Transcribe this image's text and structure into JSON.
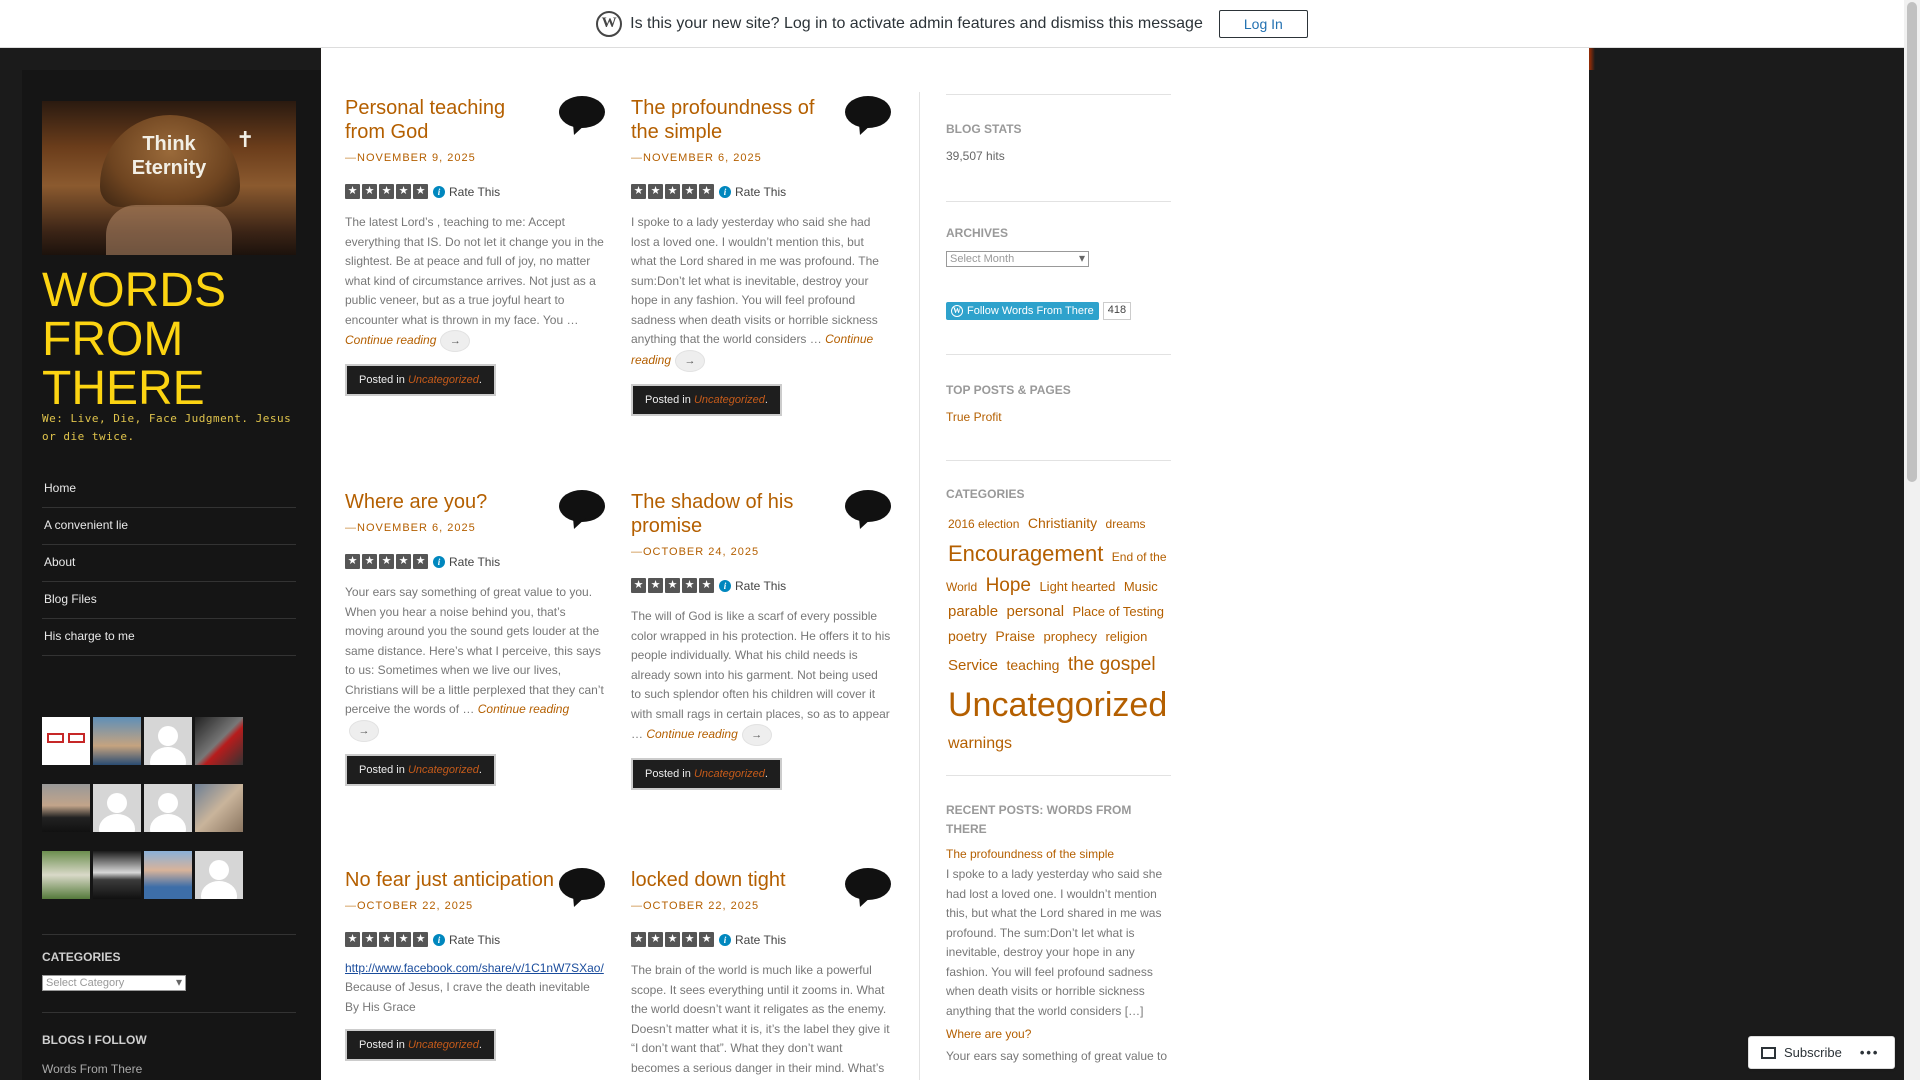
{
  "admin_notice": {
    "message": "Is this your new site? Log in to activate admin features and dismiss this message",
    "login_label": "Log In",
    "wp_glyph": "W"
  },
  "site": {
    "title": "WORDS FROM THERE",
    "description": "We: Live, Die, Face Judgment. Jesus or die twice.",
    "header_image_text": [
      "Think",
      "Eternity"
    ]
  },
  "nav": [
    "Home",
    "A convenient lie",
    "About",
    "Blog Files",
    "His charge to me"
  ],
  "sidebar": {
    "categories_title": "CATEGORIES",
    "categories_select": "Select Category",
    "blogs_title": "BLOGS I FOLLOW",
    "blogs_first": "Words From There"
  },
  "rate_label": "Rate This",
  "posted_in": "Posted in",
  "posted_category": "Uncategorized",
  "continue_label": "Continue reading",
  "posts": [
    {
      "title": "Personal teaching from God",
      "date": "NOVEMBER 9, 2025",
      "excerpt": "The latest Lord’s , teaching to me: Accept everything that IS. Do not let it change you in the slightest. Be at peace and full of joy, no matter what kind of circumstance arrives. Not just as a public veneer, but as a true joyful heart to encounter what is thrown in my face. You …"
    },
    {
      "title": "The profoundness of the simple",
      "date": "NOVEMBER 6, 2025",
      "excerpt": "I spoke to a lady yesterday who said she had lost a loved one. I wouldn’t mention this, but what the Lord shared in me was profound. The sum:Don’t let what is inevitable, destroy your hope in any fashion. You will feel profound sadness when death visits or horrible sickness anything that the world considers …"
    },
    {
      "title": "Where are you?",
      "date": "NOVEMBER 6, 2025",
      "excerpt": "Your ears say something of great value to you. When you hear a noise behind you, that’s moving around you the sound gets louder at the same distance. Here’s what I perceive, this says to us: Sometimes when we live our lives, Christians will be a little perplexed that they can’t perceive the words of …"
    },
    {
      "title": "The shadow of his promise",
      "date": "OCTOBER 24, 2025",
      "excerpt": "The will of God is like a scarf of every possible color wrapped in his protection. He offers it to his people individually. What his child needs is already sown into his garment. Not being used to such splendor often his children will cover it with small rags in certain places, so as to appear …"
    },
    {
      "title": "No fear just anticipation",
      "date": "OCTOBER 22, 2025",
      "link": "http://www.facebook.com/share/v/1C1nW7SXao/",
      "excerpt": "Because of Jesus, I crave the death inevitable By His Grace"
    },
    {
      "title": " locked down tight",
      "date": "OCTOBER 22, 2025",
      "excerpt": "The brain of the world is much like a powerful scope. It sees everything until it zooms in. What the world doesn’t want it religates as the enemy. Doesn’t matter what it is, it’s the label they give it “I don’t want that”. What they don’t want becomes a serious danger in their mind. What’s"
    }
  ],
  "right": {
    "stats_title": "BLOG STATS",
    "stats_value": "39,507 hits",
    "archives_title": "ARCHIVES",
    "archives_select": "Select Month",
    "follow_label": "Follow Words From There",
    "follow_count": "418",
    "top_title": "TOP POSTS & PAGES",
    "top_link": "True Profit",
    "categories_title": "CATEGORIES",
    "tags": [
      {
        "label": "2016 election",
        "size": 12
      },
      {
        "label": "Christianity",
        "size": 14
      },
      {
        "label": "dreams",
        "size": 12
      },
      {
        "label": "Encouragement",
        "size": 22
      },
      {
        "label": "End of the World",
        "size": 12
      },
      {
        "label": "Hope",
        "size": 19
      },
      {
        "label": "Light hearted",
        "size": 13
      },
      {
        "label": "Music",
        "size": 13
      },
      {
        "label": "parable",
        "size": 15
      },
      {
        "label": "personal",
        "size": 15
      },
      {
        "label": "Place of Testing",
        "size": 13
      },
      {
        "label": "poetry",
        "size": 14
      },
      {
        "label": "Praise",
        "size": 14
      },
      {
        "label": "prophecy",
        "size": 13
      },
      {
        "label": "religion",
        "size": 13
      },
      {
        "label": "Service",
        "size": 15
      },
      {
        "label": "teaching",
        "size": 14
      },
      {
        "label": "the gospel",
        "size": 19
      },
      {
        "label": "Uncategorized",
        "size": 34
      },
      {
        "label": "warnings",
        "size": 16
      }
    ],
    "recent_title": "RECENT POSTS: WORDS FROM THERE",
    "recent": [
      {
        "title": "The profoundness of the simple",
        "text": "I spoke to a lady yesterday who said she had lost a loved one. I wouldn’t mention this, but what the Lord shared in me was profound. The sum:Don’t let what is inevitable, destroy your hope in any fashion. You will feel profound sadness when death visits or horrible sickness anything that the world considers […]"
      },
      {
        "title": "Where are you?",
        "text": "Your ears say something of great value to"
      }
    ]
  },
  "subscribe_label": "Subscribe",
  "colors": {
    "title_yellow": "#fcd412",
    "link_orange": "#b45f00",
    "sidebar_bg": "#151515"
  }
}
